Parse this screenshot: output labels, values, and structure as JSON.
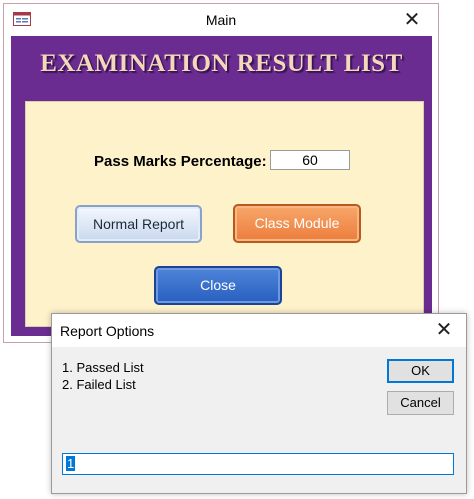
{
  "main_window": {
    "title": "Main",
    "close_label": "✕",
    "header_title": "EXAMINATION RESULT LIST",
    "pass_marks_label": "Pass Marks Percentage:",
    "pass_marks_value": "60",
    "normal_report_label": "Normal Report",
    "class_module_label": "Class Module",
    "close_button_label": "Close",
    "colors": {
      "background": "#6a2c91",
      "panel": "#fef2cb",
      "title_text": "#f3d9b9"
    }
  },
  "dialog": {
    "title": "Report Options",
    "close_label": "✕",
    "prompt_lines": [
      "1. Passed List",
      "2. Failed List"
    ],
    "ok_label": "OK",
    "cancel_label": "Cancel",
    "input_value": "1"
  }
}
